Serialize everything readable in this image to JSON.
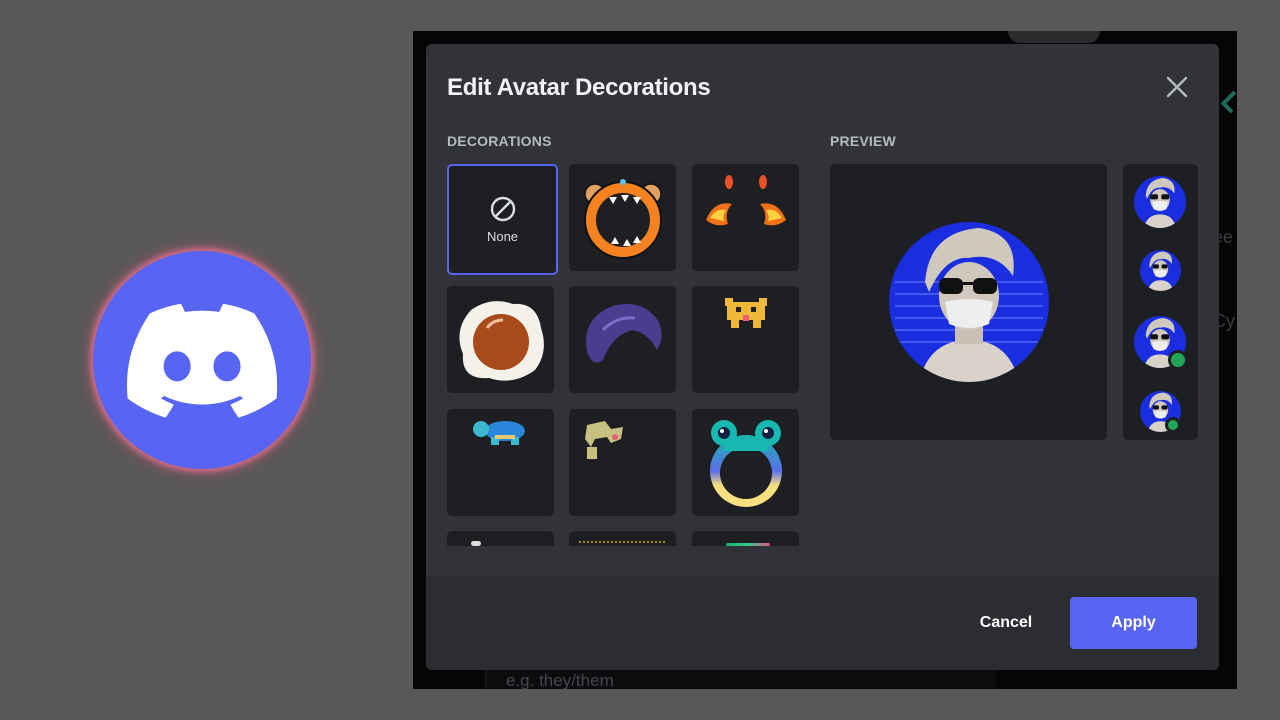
{
  "logo": {
    "name": "Discord",
    "brand_color": "#5865f2",
    "glow_color": "#e86e8c"
  },
  "background_app": {
    "peek_texts": [
      "ee",
      "Cy"
    ],
    "pronouns_placeholder": "e.g. they/them"
  },
  "modal": {
    "title": "Edit Avatar Decorations",
    "close_icon": "close-icon",
    "decorations": {
      "label": "DECORATIONS",
      "selected_index": 0,
      "items": [
        {
          "label": "None",
          "icon": "none-icon"
        },
        {
          "label": "Orange bear mouth",
          "icon": "bear-mouth-decoration"
        },
        {
          "label": "Fire horns",
          "icon": "fire-decoration"
        },
        {
          "label": "Fried egg",
          "icon": "fried-egg-decoration"
        },
        {
          "label": "Purple hair",
          "icon": "purple-hair-decoration"
        },
        {
          "label": "Pixel cat",
          "icon": "pixel-cat-decoration"
        },
        {
          "label": "Pixel turtle",
          "icon": "pixel-turtle-decoration"
        },
        {
          "label": "Pixel plant creature",
          "icon": "pixel-creature-decoration"
        },
        {
          "label": "Frog ring",
          "icon": "frog-ring-decoration"
        },
        {
          "label": "Decoration 10",
          "icon": "decoration-icon"
        },
        {
          "label": "Decoration 11",
          "icon": "decoration-icon"
        },
        {
          "label": "Decoration 12",
          "icon": "decoration-icon"
        }
      ]
    },
    "preview": {
      "label": "PREVIEW",
      "avatar_sizes": [
        "large",
        "small",
        "small-online",
        "tiny-online"
      ],
      "status_color": "#23a55a"
    },
    "footer": {
      "cancel_label": "Cancel",
      "apply_label": "Apply",
      "apply_color": "#5865f2"
    }
  }
}
